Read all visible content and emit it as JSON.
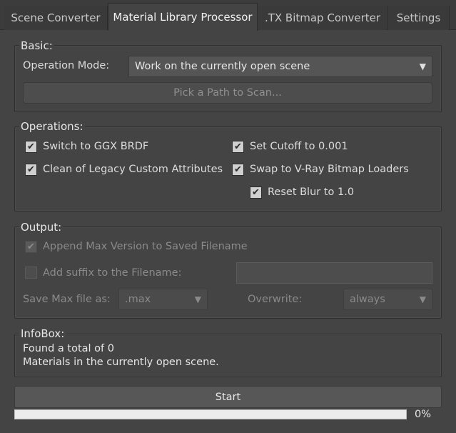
{
  "tabs": [
    {
      "label": "Scene Converter",
      "active": false
    },
    {
      "label": "Material Library Processor",
      "active": true
    },
    {
      "label": ".TX Bitmap Converter",
      "active": false
    },
    {
      "label": "Settings",
      "active": false
    }
  ],
  "basic": {
    "title": "Basic:",
    "operation_mode_label": "Operation Mode:",
    "operation_mode_value": "Work on the currently open scene",
    "pick_path_button": "Pick a Path to Scan..."
  },
  "operations": {
    "title": "Operations:",
    "checkboxes": [
      {
        "label": "Switch to GGX BRDF",
        "checked": true
      },
      {
        "label": "Clean of Legacy Custom Attributes",
        "checked": true
      },
      {
        "label": "Set Cutoff to 0.001",
        "checked": true
      },
      {
        "label": "Swap to V-Ray Bitmap Loaders",
        "checked": true
      },
      {
        "label": "Reset Blur to 1.0",
        "checked": true
      }
    ]
  },
  "output": {
    "title": "Output:",
    "append_version_label": "Append Max Version to Saved Filename",
    "append_version_checked": true,
    "add_suffix_label": "Add suffix to the Filename:",
    "add_suffix_checked": false,
    "suffix_value": "",
    "save_as_label": "Save Max file as:",
    "save_as_value": ".max",
    "overwrite_label": "Overwrite:",
    "overwrite_value": "always"
  },
  "infobox": {
    "title": "InfoBox:",
    "line1": "Found a total of 0",
    "line2": "Materials in the currently open scene."
  },
  "start_button": "Start",
  "progress": {
    "value": 0,
    "label": "0%"
  },
  "icons": {
    "dropdown_arrow": "triangle-down-icon",
    "checkmark": "check-icon"
  },
  "colors": {
    "background": "#444444",
    "checkbox_checked": "#cfcfcf",
    "progress_track": "#ececec"
  }
}
